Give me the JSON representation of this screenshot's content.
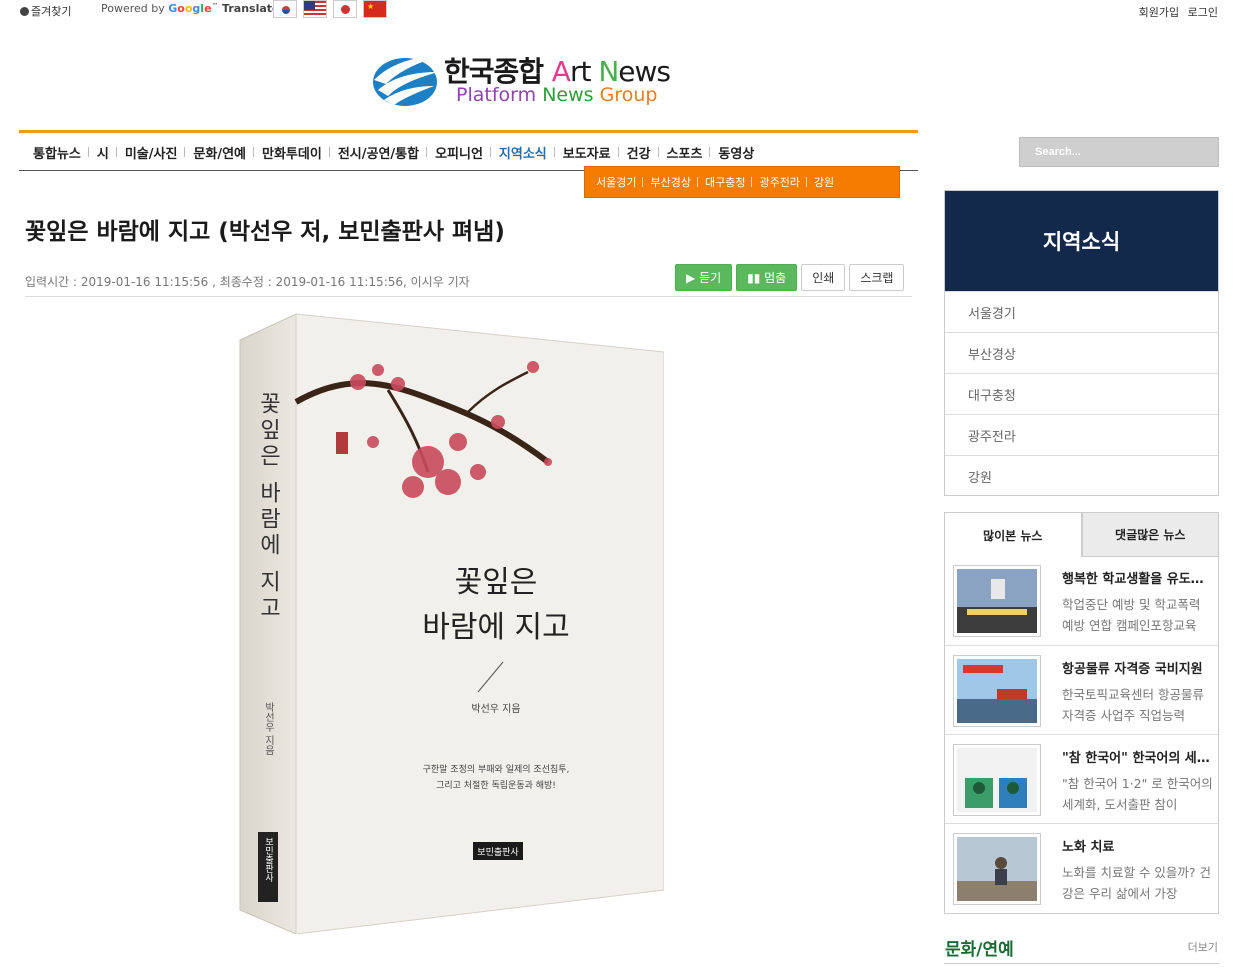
{
  "topbar": {
    "bookmark": "즐겨찾기",
    "powered_by": "Powered by",
    "google": [
      "G",
      "o",
      "o",
      "g",
      "l",
      "e"
    ],
    "tm": "™",
    "translate": "Translate",
    "flags": [
      "korea-flag-icon",
      "usa-flag-icon",
      "japan-flag-icon",
      "china-flag-icon"
    ],
    "join": "회원가입",
    "login": "로그인"
  },
  "logo": {
    "korean": "한국종합 ",
    "art_a": "A",
    "art_rest": "rt ",
    "news_n": "N",
    "news_rest": "ews",
    "line2_p": "P",
    "line2_latform": "latform ",
    "line2_n": "N",
    "line2_ews": "ews ",
    "line2_g": "G",
    "line2_roup": "roup"
  },
  "nav": {
    "items": [
      "통합뉴스",
      "시",
      "미술/사진",
      "문화/연예",
      "만화투데이",
      "전시/공연/통합",
      "오피니언",
      "지역소식",
      "보도자료",
      "건강",
      "스포츠",
      "동영상"
    ],
    "active_index": 7,
    "sub_items": [
      "서울경기",
      "부산경상",
      "대구충청",
      "광주전라",
      "강원"
    ],
    "accent_color": "#f39c12",
    "sub_color": "#f57c00"
  },
  "search": {
    "placeholder": "Search..."
  },
  "article": {
    "title": "꽃잎은 바람에 지고 (박선우 저, 보민출판사 펴냄)",
    "meta": "입력시간 : 2019-01-16 11:15:56 , 최종수정 : 2019-01-16 11:15:56, 이시우 기자",
    "buttons": {
      "listen": "▶ 듣기",
      "stop": "▮▮ 멈춤",
      "print": "인쇄",
      "scrap": "스크랩"
    },
    "book": {
      "spine_title": "꽃잎은 바람에 지고",
      "spine_author": "박선우 지음",
      "spine_publisher": "보민출판사",
      "cover_title_1": "꽃잎은",
      "cover_title_2": "바람에 지고",
      "cover_author": "박선우 지음",
      "cover_blurb_1": "구한말 조정의 부패와 일제의 조선침투,",
      "cover_blurb_2": "그리고 처절한 독립운동과 해방!",
      "cover_publisher": "보민출판사"
    }
  },
  "sidebar": {
    "region_title": "지역소식",
    "region_items": [
      "서울경기",
      "부산경상",
      "대구충청",
      "광주전라",
      "강원"
    ],
    "region_color": "#13294b",
    "tabs": [
      "많이본 뉴스",
      "댓글많은 뉴스"
    ],
    "news": [
      {
        "title": "행복한 학교생활을 유도하는 캠페인",
        "summary": "학업중단 예방 및 학교폭력 예방 연합 캠페인포항교육"
      },
      {
        "title": "항공물류 자격증 국비지원",
        "summary": "한국토픽교육센터 항공물류 자격증 사업주 직업능력"
      },
      {
        "title": "\"참 한국어\" 한국어의 세계화",
        "summary": "\"참 한국어 1·2\" 로 한국어의 세계화, 도서출판 참이"
      },
      {
        "title": "노화 치료",
        "summary": "노화를 치료할 수 있을까? 건강은 우리 삶에서 가장"
      }
    ],
    "section_title": "문화/연예",
    "section_more": "더보기"
  }
}
